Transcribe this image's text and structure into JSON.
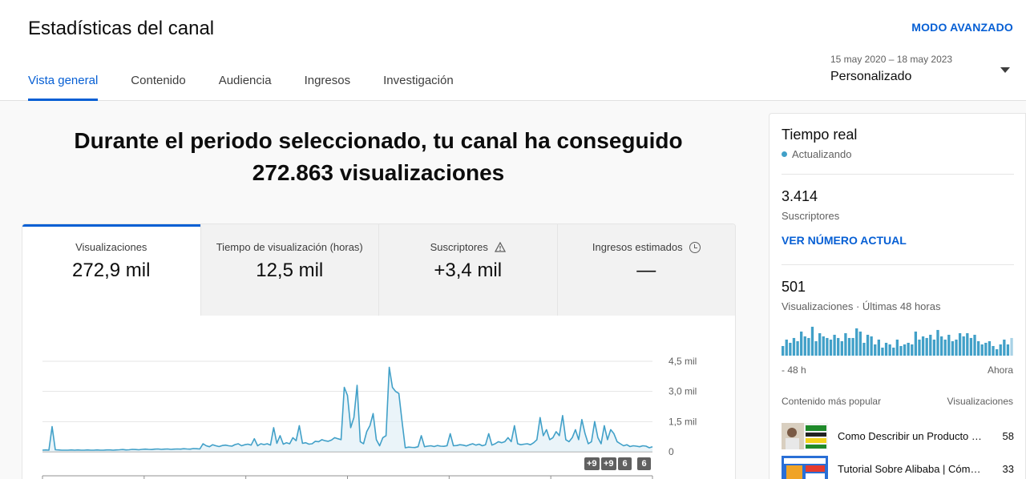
{
  "header": {
    "title": "Estadísticas del canal",
    "advanced_mode": "MODO AVANZADO",
    "tabs": [
      {
        "label": "Vista general",
        "active": true
      },
      {
        "label": "Contenido"
      },
      {
        "label": "Audiencia"
      },
      {
        "label": "Ingresos"
      },
      {
        "label": "Investigación"
      }
    ],
    "date_range": "15 may 2020 – 18 may 2023",
    "date_mode": "Personalizado"
  },
  "headline": {
    "line1": "Durante el periodo seleccionado, tu canal ha conseguido",
    "line2": "272.863 visualizaciones"
  },
  "metrics": [
    {
      "label": "Visualizaciones",
      "value": "272,9 mil",
      "active": true
    },
    {
      "label": "Tiempo de visualización (horas)",
      "value": "12,5 mil"
    },
    {
      "label": "Suscriptores",
      "value": "+3,4 mil",
      "icon": "warning-icon"
    },
    {
      "label": "Ingresos estimados",
      "value": "—",
      "icon": "clock-icon"
    }
  ],
  "chart_data": {
    "type": "line",
    "series": [
      {
        "name": "Visualizaciones",
        "values": [
          80,
          90,
          80,
          1250,
          100,
          90,
          80,
          80,
          80,
          90,
          80,
          90,
          80,
          80,
          90,
          80,
          80,
          90,
          80,
          80,
          90,
          90,
          80,
          90,
          100,
          110,
          90,
          100,
          120,
          110,
          100,
          120,
          130,
          120,
          110,
          130,
          140,
          120,
          130,
          140,
          120,
          130,
          140,
          130,
          150,
          140,
          130,
          160,
          150,
          140,
          400,
          300,
          250,
          350,
          300,
          260,
          310,
          330,
          300,
          280,
          360,
          400,
          300,
          350,
          380,
          330,
          650,
          300,
          400,
          360,
          400,
          330,
          1200,
          420,
          800,
          380,
          450,
          400,
          700,
          550,
          1300,
          420,
          450,
          380,
          400,
          520,
          500,
          600,
          550,
          520,
          580,
          700,
          650,
          600,
          3200,
          2800,
          1200,
          1700,
          3300,
          500,
          400,
          1000,
          1300,
          1900,
          600,
          300,
          700,
          800,
          4200,
          3200,
          3000,
          2900,
          1500,
          200,
          230,
          220,
          210,
          250,
          800,
          250,
          280,
          300,
          260,
          310,
          280,
          270,
          300,
          900,
          300,
          310,
          350,
          330,
          290,
          350,
          400,
          330,
          380,
          300,
          350,
          900,
          330,
          400,
          500,
          450,
          500,
          700,
          500,
          1300,
          400,
          350,
          380,
          400,
          350,
          450,
          600,
          1700,
          800,
          1100,
          600,
          700,
          1000,
          800,
          1800,
          600,
          500,
          700,
          1100,
          600,
          1600,
          900,
          400,
          500,
          1500,
          700,
          400,
          1300,
          600,
          1100,
          900,
          500,
          400,
          300,
          350,
          260,
          300,
          280,
          250,
          300,
          280,
          200,
          250
        ]
      }
    ],
    "yticks": [
      "4,5 mil",
      "3,0 mil",
      "1,5 mil",
      "0"
    ],
    "ylim": [
      0,
      4500
    ],
    "markers": [
      "+9",
      "+9",
      "6",
      "6"
    ]
  },
  "realtime": {
    "title": "Tiempo real",
    "status": "Actualizando",
    "subscribers": "3.414",
    "subscribers_label": "Suscriptores",
    "link": "VER NÚMERO ACTUAL",
    "views": "501",
    "views_label": "Visualizaciones · Últimas 48 horas",
    "bars": [
      6,
      10,
      8,
      11,
      9,
      15,
      12,
      11,
      18,
      9,
      14,
      12,
      11,
      10,
      13,
      11,
      9,
      14,
      11,
      11,
      17,
      15,
      8,
      13,
      12,
      7,
      10,
      5,
      8,
      7,
      5,
      10,
      6,
      7,
      8,
      7,
      15,
      10,
      12,
      11,
      13,
      10,
      16,
      12,
      10,
      13,
      9,
      10,
      14,
      12,
      14,
      11,
      13,
      9,
      7,
      8,
      9,
      6,
      4,
      7,
      10,
      7,
      11
    ],
    "axis_left": "- 48 h",
    "axis_right": "Ahora",
    "popular_heading": "Contenido más popular",
    "popular_col": "Visualizaciones",
    "videos": [
      {
        "title": "Como Describir un Producto de Amazon",
        "views": "58"
      },
      {
        "title": "Tutorial Sobre Alibaba | Cómo Comprar",
        "views": "33"
      }
    ]
  },
  "colors": {
    "accent": "#065fd4",
    "line": "#41a0c8",
    "fill": "#dcecf5"
  }
}
